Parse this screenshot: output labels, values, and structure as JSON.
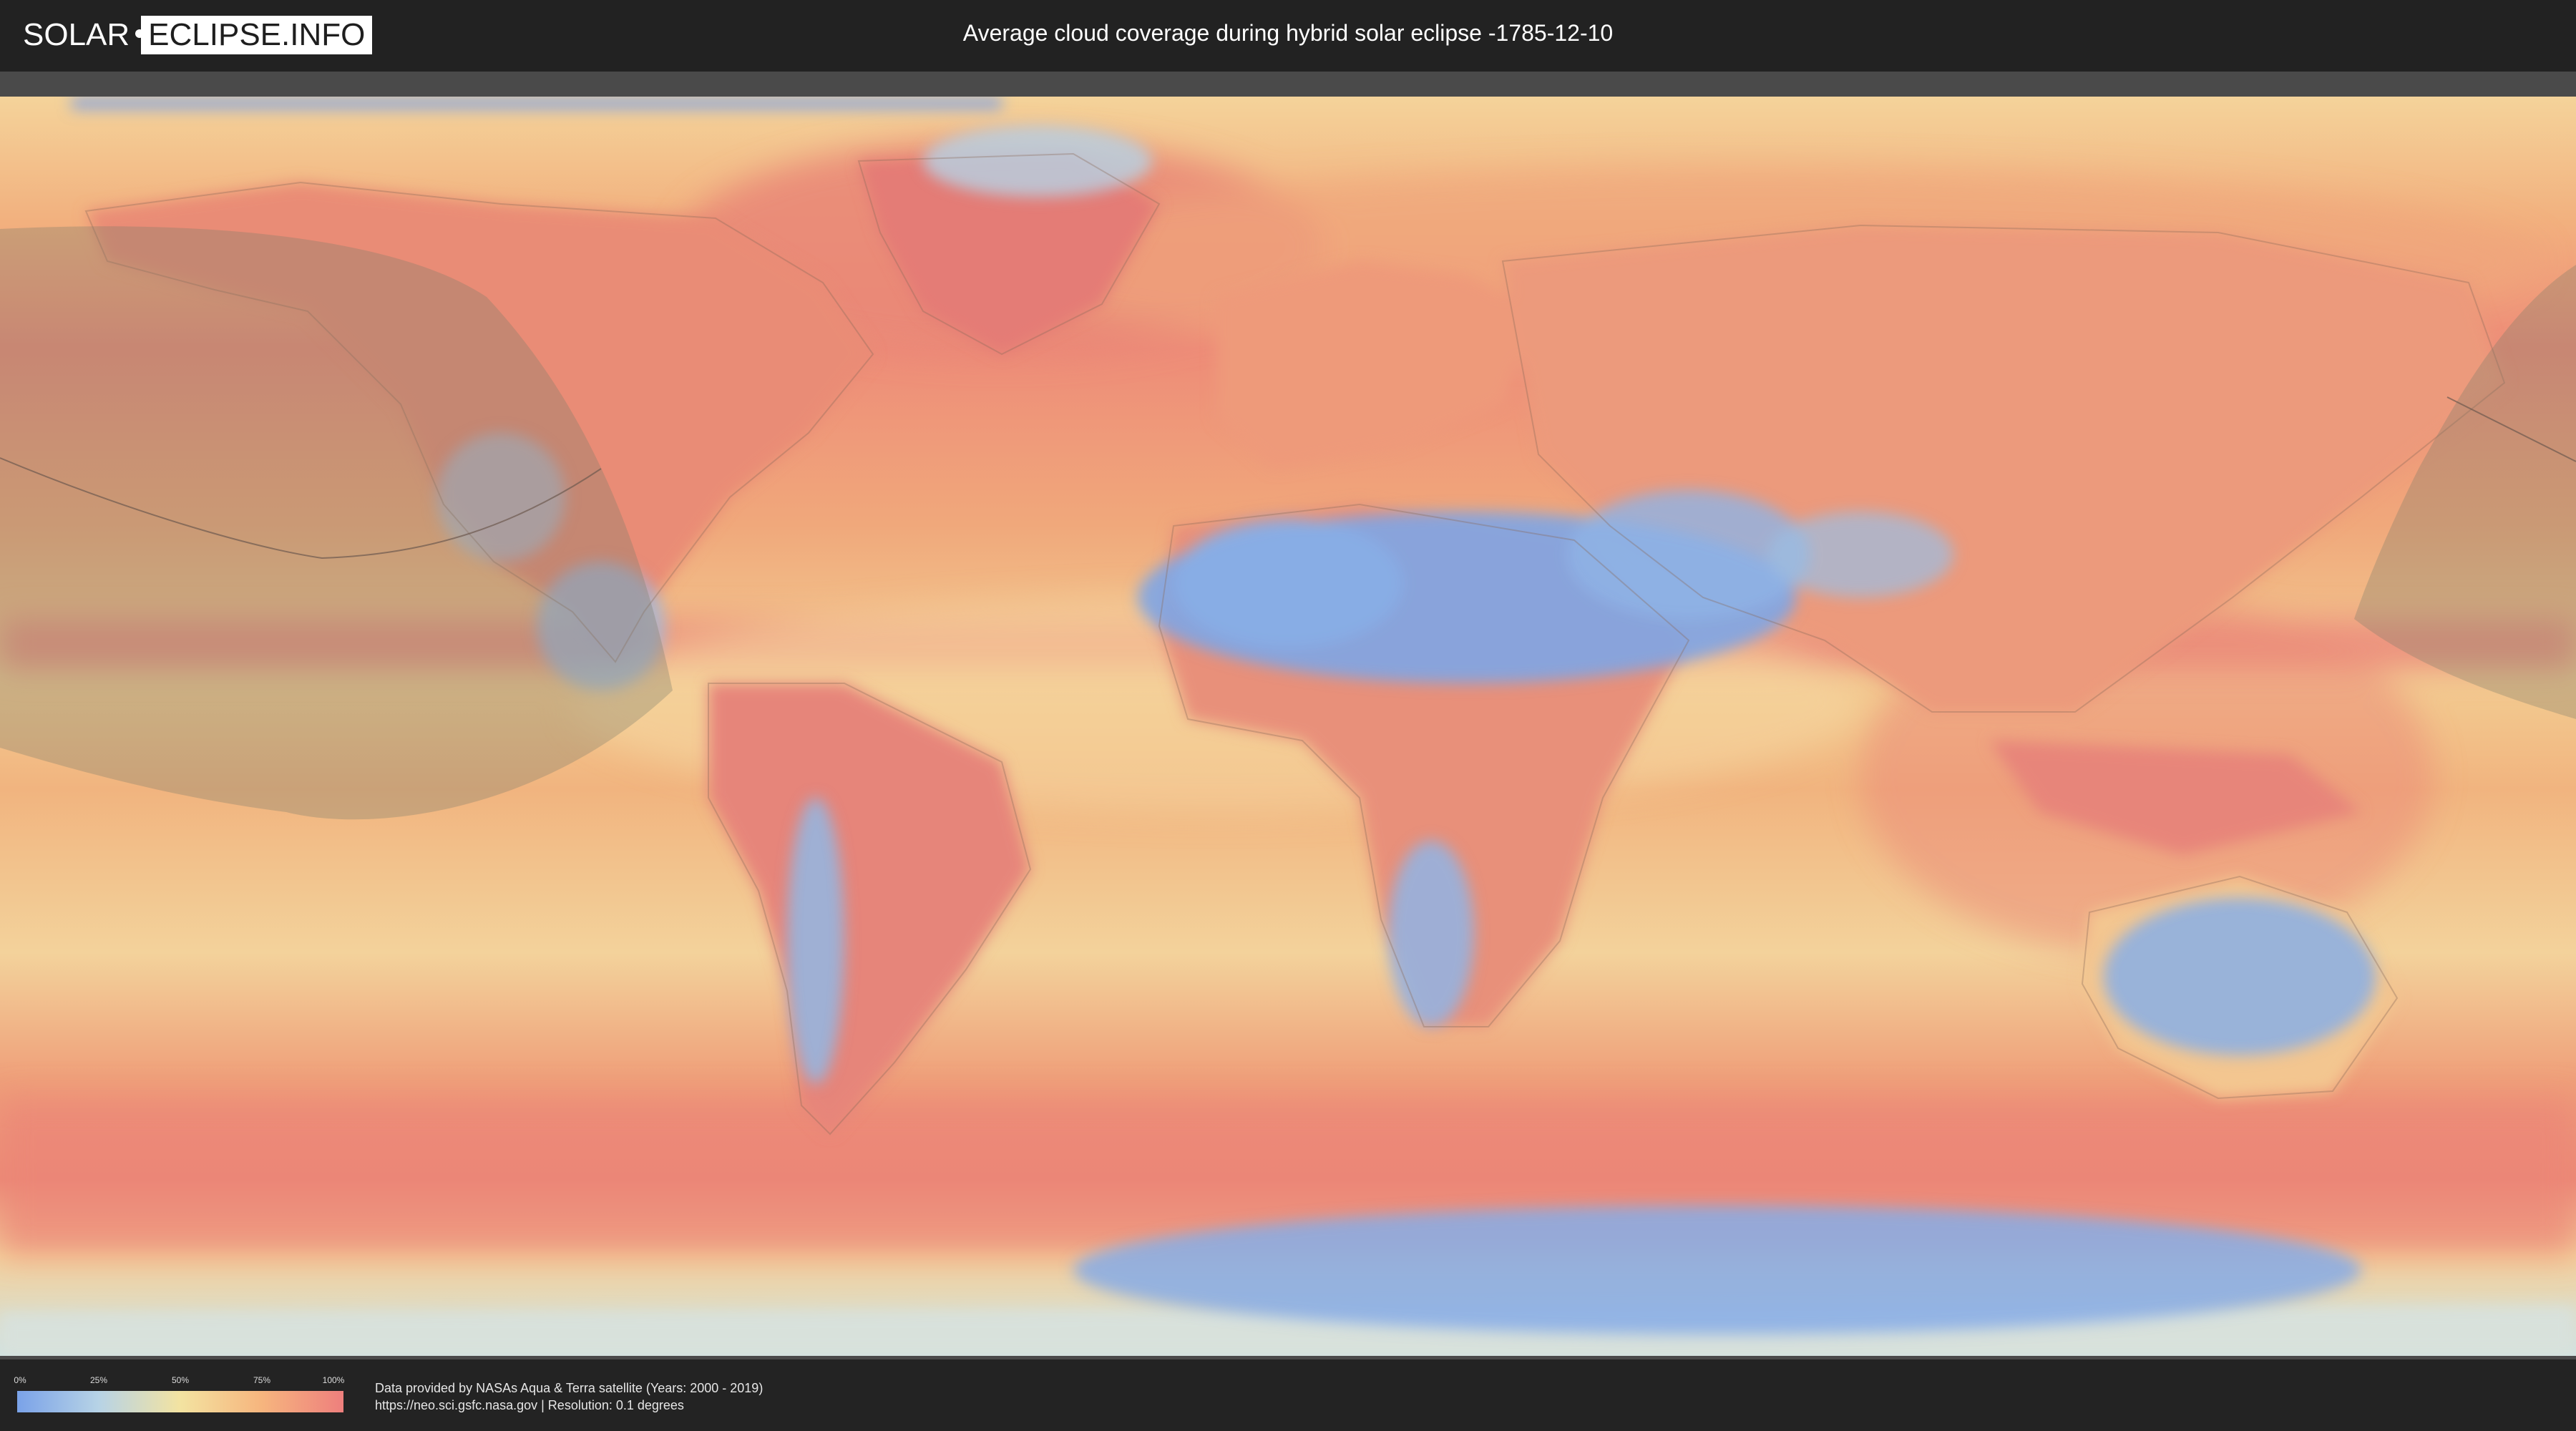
{
  "header": {
    "logo_left": "SOLAR",
    "logo_right": "ECLIPSE.INFO",
    "title": "Average cloud coverage during hybrid solar eclipse -1785-12-10"
  },
  "legend": {
    "ticks": [
      "0%",
      "25%",
      "50%",
      "75%",
      "100%"
    ],
    "colors": [
      "#7aa2e8",
      "#b7d3e6",
      "#f3e3a1",
      "#f6b57e",
      "#ee7f7d"
    ]
  },
  "footer": {
    "line1": "Data provided by NASAs Aqua & Terra satellite (Years: 2000 - 2019)",
    "line2": "https://neo.sci.gsfc.nasa.gov | Resolution: 0.1 degrees"
  },
  "map": {
    "ocean_color": "#f5c58c",
    "land_color": "#e78b74",
    "shadow_color": "#8a8a74"
  }
}
